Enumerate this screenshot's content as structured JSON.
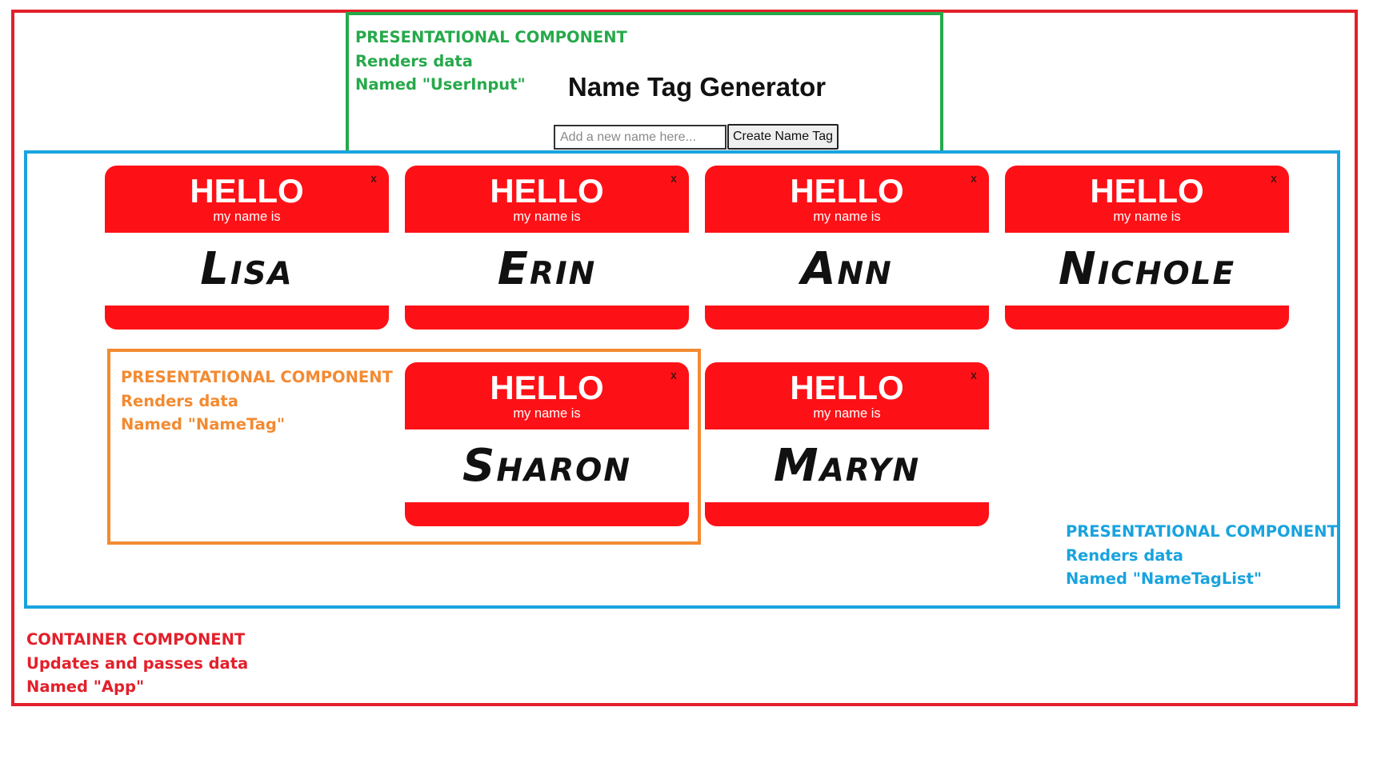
{
  "app": {
    "title": "Name Tag Generator",
    "input_placeholder": "Add a new name here...",
    "input_value": "",
    "create_button_label": "Create Name Tag"
  },
  "annotations": {
    "app": [
      "CONTAINER COMPONENT",
      "Updates and passes data",
      "Named \"App\""
    ],
    "user_input": [
      "PRESENTATIONAL COMPONENT",
      "Renders data",
      "Named \"UserInput\""
    ],
    "name_tag_list": [
      "PRESENTATIONAL COMPONENT",
      "Renders data",
      "Named \"NameTagList\""
    ],
    "name_tag": [
      "PRESENTATIONAL COMPONENT",
      "Renders data",
      "Named \"NameTag\""
    ]
  },
  "tag_template": {
    "hello": "HELLO",
    "subtitle": "my name is",
    "close": "x"
  },
  "name_tags": [
    {
      "name": "Lisa"
    },
    {
      "name": "Erin"
    },
    {
      "name": "Ann"
    },
    {
      "name": "Nichole"
    },
    {
      "name": "Sharon"
    },
    {
      "name": "Maryn"
    }
  ],
  "colors": {
    "tag_red": "#fd1117",
    "app_outline": "#e3202b",
    "user_input_outline": "#26a94a",
    "name_tag_list_outline": "#19a3de",
    "name_tag_outline": "#f38a31"
  }
}
